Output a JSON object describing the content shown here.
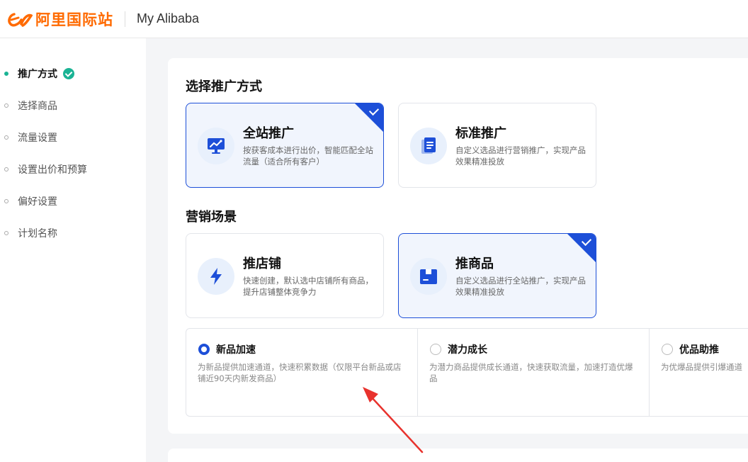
{
  "header": {
    "logo_text": "阿里国际站",
    "title": "My Alibaba"
  },
  "sidebar": {
    "steps": [
      {
        "label": "推广方式",
        "active": true,
        "completed": true
      },
      {
        "label": "选择商品",
        "active": false
      },
      {
        "label": "流量设置",
        "active": false
      },
      {
        "label": "设置出价和预算",
        "active": false
      },
      {
        "label": "偏好设置",
        "active": false
      },
      {
        "label": "计划名称",
        "active": false
      }
    ]
  },
  "promotion": {
    "section_title": "选择推广方式",
    "cards": [
      {
        "title": "全站推广",
        "desc": "按获客成本进行出价，智能匹配全站流量（适合所有客户）",
        "selected": true,
        "icon": "monitor-chart-icon"
      },
      {
        "title": "标准推广",
        "desc": "自定义选品进行营销推广，实现产品效果精准投放",
        "selected": false,
        "icon": "document-stack-icon"
      }
    ]
  },
  "scene": {
    "section_title": "营销场景",
    "cards": [
      {
        "title": "推店铺",
        "desc": "快速创建，默认选中店铺所有商品，提升店铺整体竞争力",
        "selected": false,
        "icon": "lightning-icon"
      },
      {
        "title": "推商品",
        "desc": "自定义选品进行全站推广，实现产品效果精准投放",
        "selected": true,
        "icon": "product-box-icon"
      }
    ],
    "options": [
      {
        "title": "新品加速",
        "desc": "为新品提供加速通道，快速积累数据（仅限平台新品或店铺近90天内新发商品）",
        "checked": true
      },
      {
        "title": "潜力成长",
        "desc": "为潜力商品提供成长通道，快速获取流量，加速打造优爆品",
        "checked": false
      },
      {
        "title": "优品助推",
        "desc": "为优爆品提供引爆通道",
        "checked": false
      }
    ]
  },
  "colors": {
    "accent": "#1d4fd8",
    "brand": "#ff6a00",
    "success": "#1ab394",
    "annotation": "#e8322d"
  }
}
